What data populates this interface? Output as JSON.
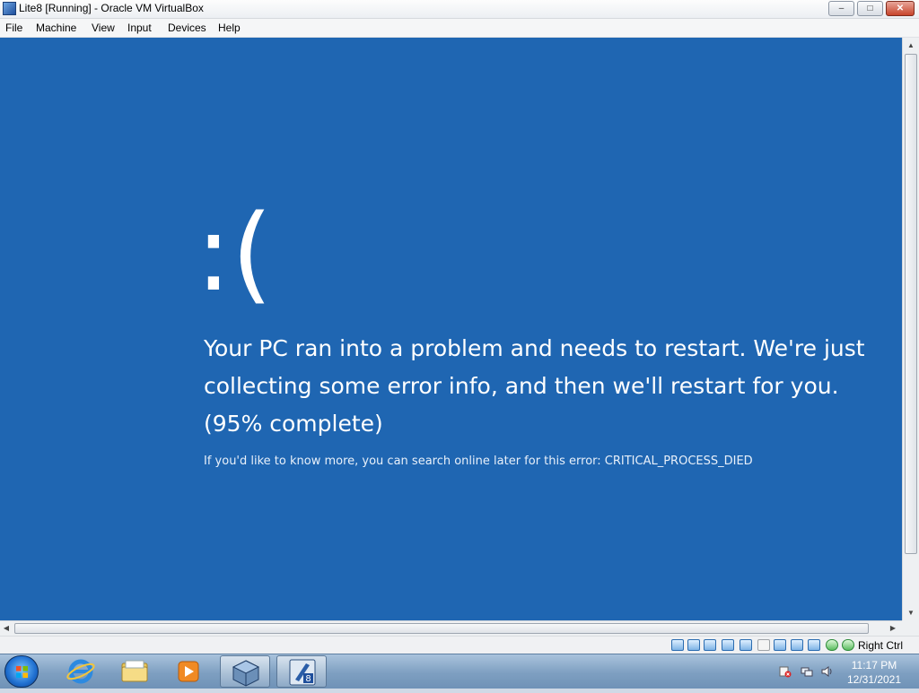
{
  "window": {
    "title": "Lite8 [Running] - Oracle VM VirtualBox",
    "controls": {
      "minimize": "–",
      "maximize": "□",
      "close": "✕"
    }
  },
  "menu": {
    "items": [
      "File",
      "Machine",
      "View",
      "Input",
      "Devices",
      "Help"
    ]
  },
  "bsod": {
    "face": ":(",
    "message": "Your PC ran into a problem and needs to restart. We're just collecting some error info, and then we'll restart for you. (95% complete)",
    "hint": "If you'd like to know more, you can search online later for this error: CRITICAL_PROCESS_DIED",
    "progress_percent": 95,
    "background_color": "#1f66b2"
  },
  "statusbar": {
    "host_key": "Right Ctrl",
    "icons": [
      "hard-disk-icon",
      "optical-drive-icon",
      "audio-icon",
      "network-icon",
      "usb-icon",
      "shared-folders-icon",
      "display-icon",
      "video-capture-icon",
      "virtualization-icon",
      "mouse-integration-icon",
      "keyboard-icon"
    ]
  },
  "taskbar": {
    "apps": [
      "internet-explorer-icon",
      "file-explorer-icon",
      "media-player-icon",
      "virtualbox-icon",
      "vm-lite8-icon"
    ],
    "tray_icons": [
      "action-center-icon",
      "network-icon",
      "volume-icon"
    ],
    "time": "11:17 PM",
    "date": "12/31/2021"
  }
}
